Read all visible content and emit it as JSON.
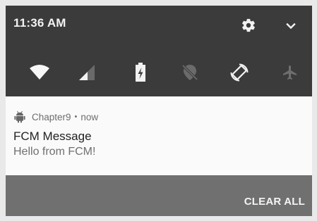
{
  "status_bar": {
    "time": "11:36 AM",
    "settings_icon": "gear-icon",
    "expand_icon": "chevron-down-icon"
  },
  "quick_settings": [
    {
      "name": "wifi",
      "icon": "wifi-icon"
    },
    {
      "name": "cellular",
      "icon": "cellular-signal-icon"
    },
    {
      "name": "battery",
      "icon": "battery-charging-icon"
    },
    {
      "name": "location",
      "icon": "location-off-icon"
    },
    {
      "name": "auto-rotate",
      "icon": "rotate-icon"
    },
    {
      "name": "airplane-mode",
      "icon": "airplane-icon"
    }
  ],
  "notification": {
    "app_icon": "android-icon",
    "app_name": "Chapter9",
    "separator": "•",
    "time": "now",
    "title": "FCM Message",
    "body": "Hello from FCM!"
  },
  "footer": {
    "clear_all": "CLEAR ALL"
  },
  "colors": {
    "quick_settings_bg": "#3b3b3b",
    "notification_bg": "#fafafa",
    "shade_bg": "#707070"
  }
}
